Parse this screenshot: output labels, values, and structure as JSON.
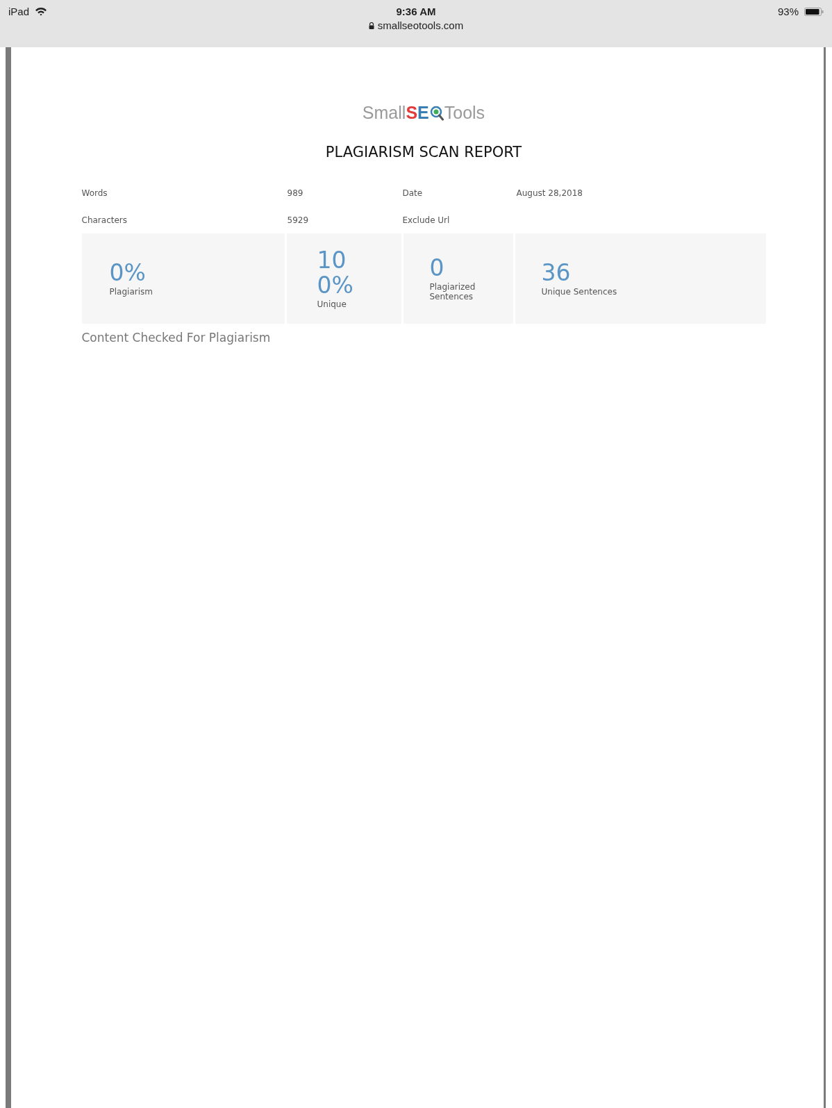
{
  "status_bar": {
    "device": "iPad",
    "time": "9:36 AM",
    "url": "smallseotools.com",
    "battery_text": "93%"
  },
  "logo": {
    "prefix": "Small",
    "accent": [
      "S",
      "E"
    ],
    "suffix": "Tools"
  },
  "title": "PLAGIARISM SCAN REPORT",
  "info": [
    {
      "label": "Words",
      "value": "989"
    },
    {
      "label": "Date",
      "value": "August 28,2018"
    },
    {
      "label": "Characters",
      "value": "5929"
    },
    {
      "label": "Exclude Url"
    }
  ],
  "stats": [
    {
      "value": "0%",
      "label": "Plagiarism"
    },
    {
      "value": "100%",
      "label": "Unique"
    },
    {
      "value": "0",
      "label": "Plagiarized Sentences"
    },
    {
      "value": "36",
      "label": "Unique Sentences"
    }
  ],
  "section_heading": "Content Checked For Plagiarism"
}
